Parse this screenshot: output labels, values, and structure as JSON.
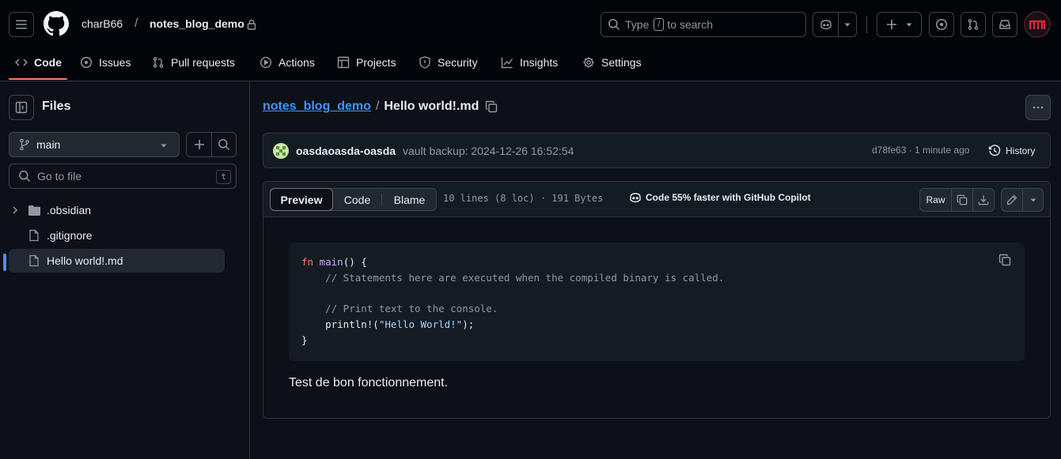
{
  "header": {
    "owner": "charB66",
    "separator": "/",
    "repo": "notes_blog_demo",
    "search_placeholder_prefix": "Type",
    "search_key": "/",
    "search_placeholder_suffix": "to search"
  },
  "nav": {
    "tabs": [
      {
        "label": "Code",
        "icon": "code-icon",
        "active": true
      },
      {
        "label": "Issues",
        "icon": "issue-icon"
      },
      {
        "label": "Pull requests",
        "icon": "pull-request-icon"
      },
      {
        "label": "Actions",
        "icon": "play-icon"
      },
      {
        "label": "Projects",
        "icon": "table-icon"
      },
      {
        "label": "Security",
        "icon": "shield-icon"
      },
      {
        "label": "Insights",
        "icon": "graph-icon"
      },
      {
        "label": "Settings",
        "icon": "gear-icon"
      }
    ]
  },
  "sidebar": {
    "title": "Files",
    "branch": "main",
    "go_to_file_placeholder": "Go to file",
    "shortcut": "t",
    "files": [
      {
        "name": ".obsidian",
        "type": "folder"
      },
      {
        "name": ".gitignore",
        "type": "file"
      },
      {
        "name": "Hello world!.md",
        "type": "file",
        "selected": true
      }
    ]
  },
  "breadcrumb": {
    "repo": "notes_blog_demo",
    "separator": "/",
    "file": "Hello world!.md"
  },
  "commit": {
    "author": "oasdaoasda-oasda",
    "message": "vault backup: 2024-12-26 16:52:54",
    "sha_time": "d78fe63 · 1 minute ago",
    "history_label": "History"
  },
  "file_toolbar": {
    "tabs": [
      "Preview",
      "Code",
      "Blame"
    ],
    "info": "10 lines (8 loc) · 191 Bytes",
    "copilot": "Code 55% faster with GitHub Copilot",
    "raw_label": "Raw"
  },
  "content": {
    "code_lines": [
      [
        {
          "t": "fn",
          "c": "kw"
        },
        {
          "t": " ",
          "c": ""
        },
        {
          "t": "main",
          "c": "fn"
        },
        {
          "t": "() {",
          "c": ""
        }
      ],
      [
        {
          "t": "    // Statements here are executed when the compiled binary is called.",
          "c": "cm"
        }
      ],
      [
        {
          "t": "",
          "c": ""
        }
      ],
      [
        {
          "t": "    // Print text to the console.",
          "c": "cm"
        }
      ],
      [
        {
          "t": "    println!(",
          "c": ""
        },
        {
          "t": "\"Hello World!\"",
          "c": "st"
        },
        {
          "t": ");",
          "c": ""
        }
      ],
      [
        {
          "t": "}",
          "c": ""
        }
      ]
    ],
    "paragraph": "Test de bon fonctionnement."
  },
  "colors": {
    "accent_link": "#4493f8",
    "active_underline": "#f78166",
    "selected_bar": "#4493f8"
  }
}
